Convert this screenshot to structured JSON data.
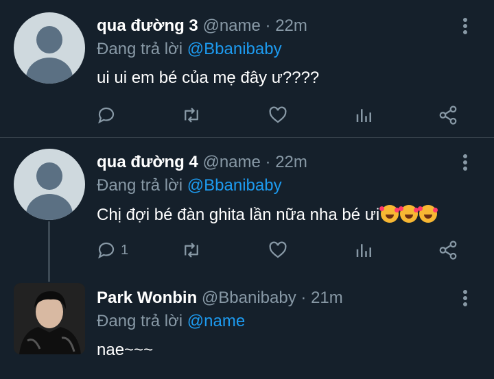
{
  "tweets": [
    {
      "name": "qua đường 3",
      "handle": "@name",
      "dot": "·",
      "time": "22m",
      "reply_prefix": "Đang trả lời",
      "reply_to": "@Bbanibaby",
      "text": "ui ui em bé của mẹ đây ư????",
      "reply_count": "",
      "avatar": "default-avatar"
    },
    {
      "name": "qua đường 4",
      "handle": "@name",
      "dot": "·",
      "time": "22m",
      "reply_prefix": "Đang trả lời",
      "reply_to": "@Bbanibaby",
      "text": "Chị đợi bé đàn ghita lần nữa nha bé ưi",
      "emojis": [
        "smiling-face-with-hearts",
        "smiling-face-with-hearts",
        "smiling-face-with-hearts"
      ],
      "reply_count": "1",
      "avatar": "default-avatar"
    },
    {
      "name": "Park Wonbin",
      "handle": "@Bbanibaby",
      "dot": "·",
      "time": "21m",
      "reply_prefix": "Đang trả lời",
      "reply_to": "@name",
      "text": "nae~~~",
      "avatar": "profile-photo"
    }
  ],
  "icons": {
    "reply": "reply-icon",
    "retweet": "retweet-icon",
    "like": "heart-icon",
    "views": "analytics-icon",
    "share": "share-icon",
    "more": "more-vertical-icon"
  },
  "colors": {
    "background": "#15202b",
    "secondary_text": "#8899a6",
    "mention": "#1d9bf0",
    "divider": "#38444d"
  }
}
